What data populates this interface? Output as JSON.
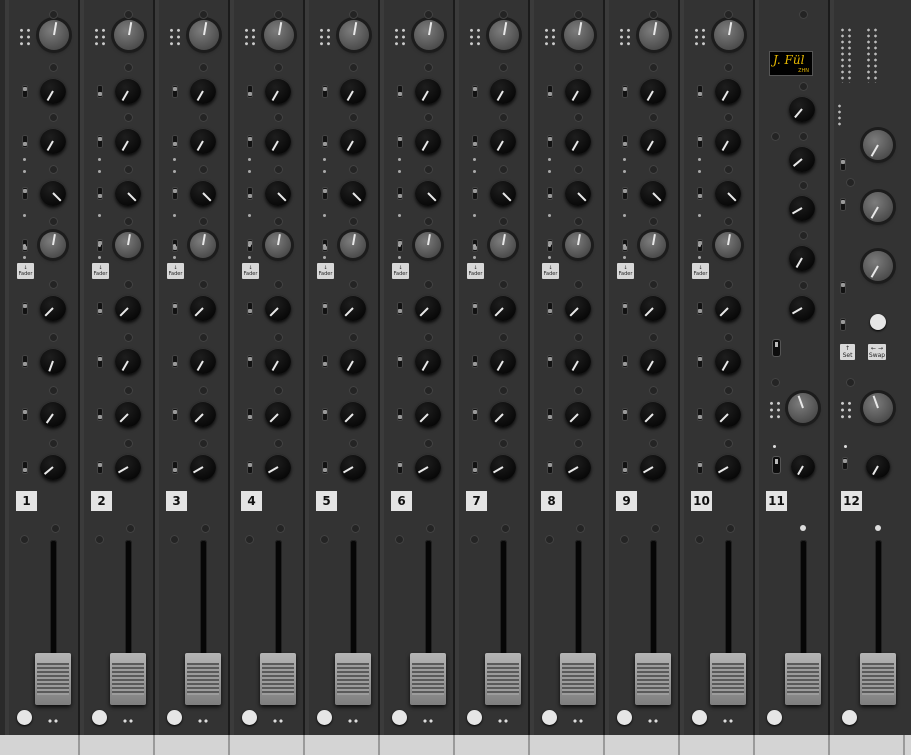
{
  "channels": [
    {
      "number": "1"
    },
    {
      "number": "2"
    },
    {
      "number": "3"
    },
    {
      "number": "4"
    },
    {
      "number": "5"
    },
    {
      "number": "6"
    },
    {
      "number": "7"
    },
    {
      "number": "8"
    },
    {
      "number": "9"
    },
    {
      "number": "10"
    }
  ],
  "aux_channel": {
    "number": "11"
  },
  "master_channel": {
    "number": "12"
  },
  "labels": {
    "fader_button": "Fader",
    "fader_arrow": "↓",
    "set_button": "Set",
    "swap_button": "Swap",
    "set_arrow": "↑",
    "swap_arrow": "← →"
  },
  "logo": {
    "signature": "J. Fül",
    "subtitle": "ZHN"
  },
  "colors": {
    "panel": "#333333",
    "knob": "#0c0c0c",
    "gain_knob": "#6a6a6a",
    "label": "#e4e4e4",
    "logo_text": "#e6b800"
  }
}
